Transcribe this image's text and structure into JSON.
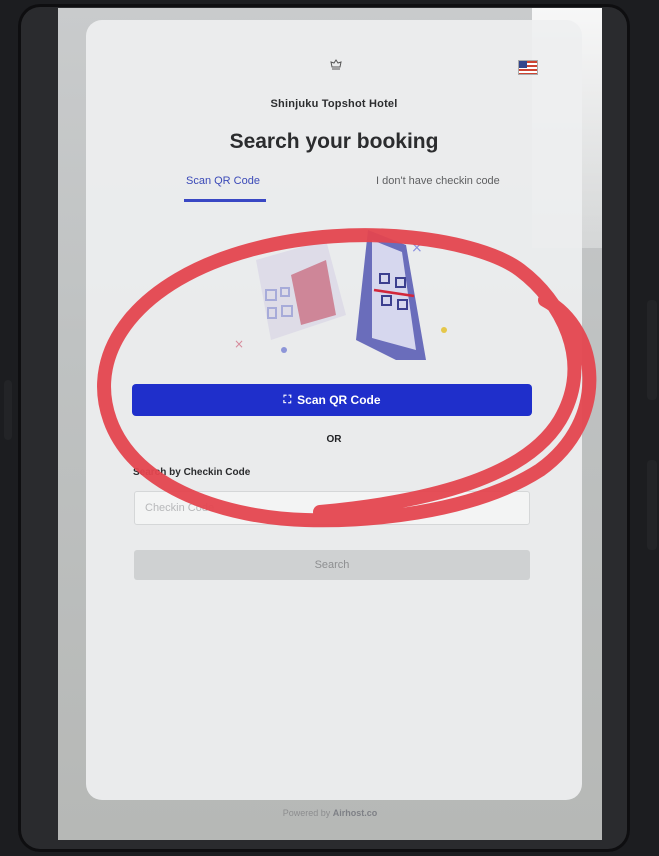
{
  "app": {
    "hotel_name": "Shinjuku Topshot Hotel",
    "title": "Search your booking",
    "language_flag": "us-flag-icon"
  },
  "tabs": [
    {
      "label": "Scan QR Code",
      "active": true
    },
    {
      "label": "I don't have checkin code",
      "active": false
    }
  ],
  "scan": {
    "button_label": "Scan QR Code",
    "button_icon": "qr-scan-icon",
    "button_color": "#1f2fcb"
  },
  "divider": {
    "label": "OR"
  },
  "checkin": {
    "label": "Search by Checkin Code",
    "input_value": "",
    "input_placeholder": "Checkin Code",
    "search_label": "Search"
  },
  "footer": {
    "powered_by": "Powered by",
    "brand": "Airhost.co"
  },
  "annotation": {
    "shape": "hand-drawn ellipse",
    "color": "#e4464f"
  }
}
